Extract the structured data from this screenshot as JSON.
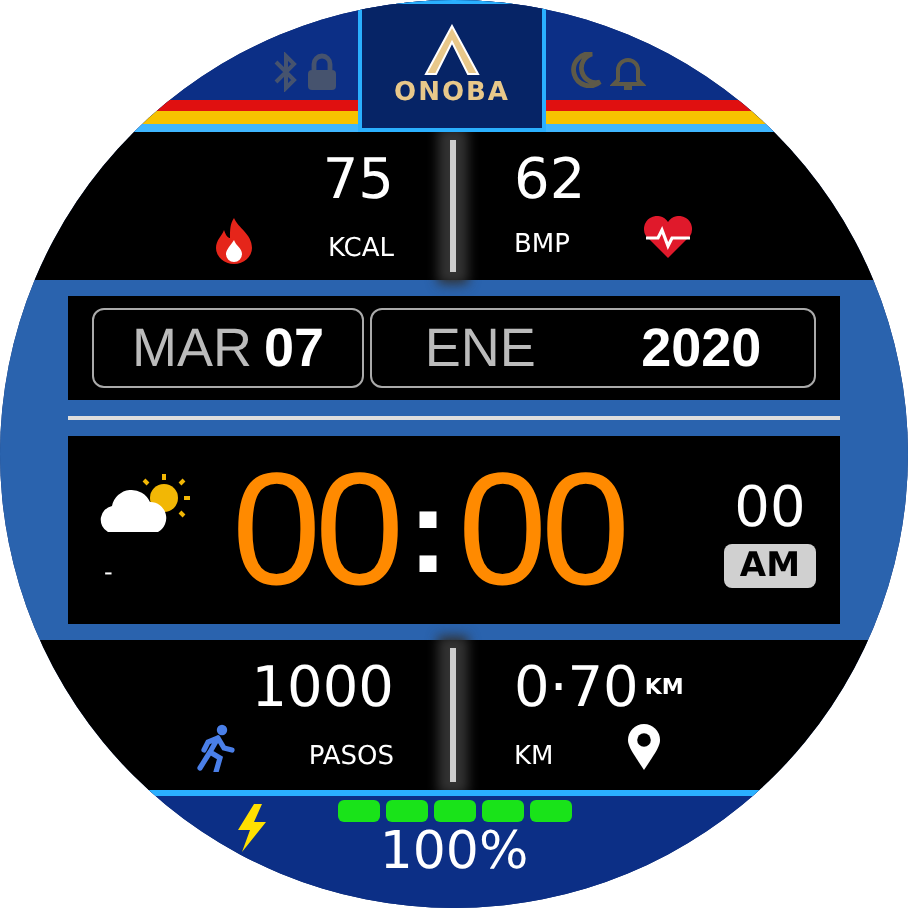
{
  "header": {
    "logo": "ONOBA"
  },
  "top_stats": [
    {
      "value": "75",
      "unit": "KCAL",
      "kind": "calories"
    },
    {
      "value": "62",
      "unit": "BMP",
      "kind": "heart"
    }
  ],
  "date": {
    "weekday": "MAR",
    "day": "07",
    "month": "ENE",
    "year": "2020"
  },
  "weather": {
    "temperature": "-"
  },
  "time": {
    "hours": "00",
    "separator": ":",
    "minutes": "00",
    "seconds": "00",
    "period": "AM"
  },
  "bottom_stats": [
    {
      "value": "1000",
      "unit": "PASOS",
      "kind": "steps"
    },
    {
      "value": "0·70",
      "unit_superscript": "KM",
      "unit": "KM",
      "kind": "distance"
    }
  ],
  "battery": {
    "reading": "100%"
  }
}
